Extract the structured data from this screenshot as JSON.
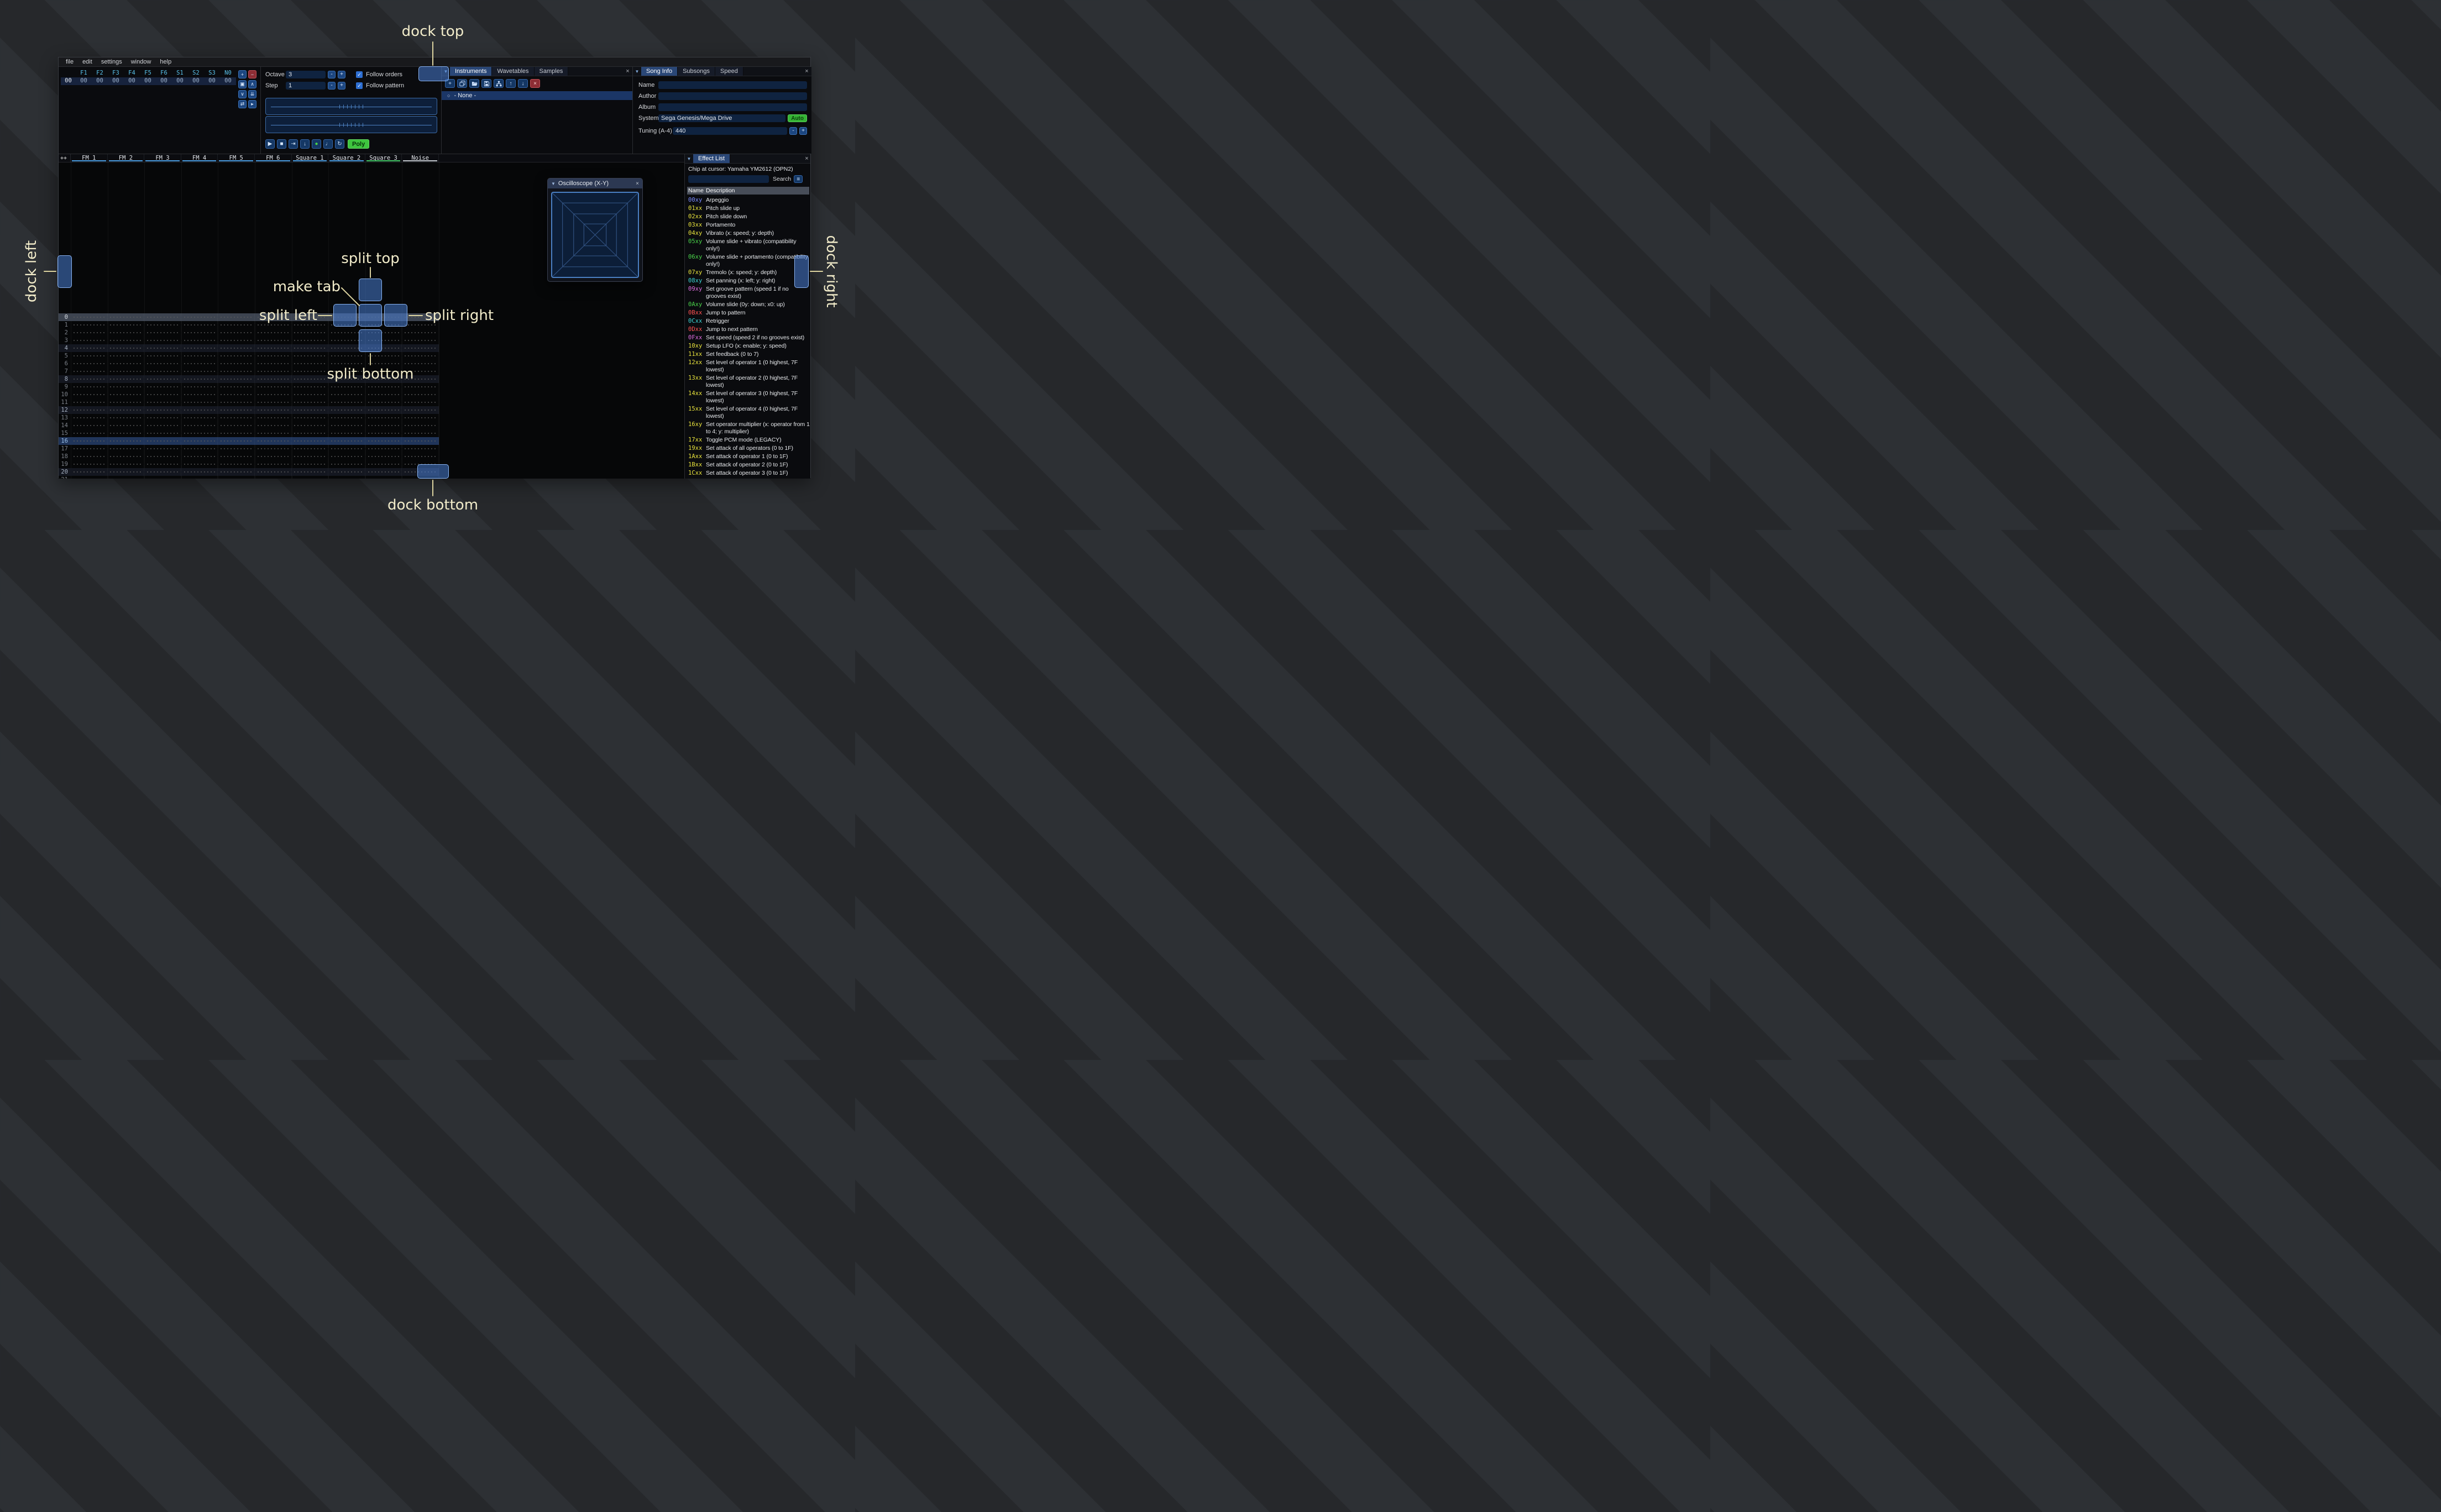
{
  "icons": {
    "collapse": "▼",
    "close": "×",
    "check": "✓",
    "hamburger": "≡",
    "instrument_none": "○",
    "minus": "-",
    "plus": "+"
  },
  "annotations": {
    "dock_top": "dock top",
    "dock_bottom": "dock bottom",
    "dock_left": "dock left",
    "dock_right": "dock right",
    "split_top": "split top",
    "split_bottom": "split bottom",
    "split_left": "split left",
    "split_right": "split right",
    "make_tab": "make tab"
  },
  "menu": {
    "items": [
      "file",
      "edit",
      "settings",
      "window",
      "help"
    ]
  },
  "orders": {
    "header": [
      "F1",
      "F2",
      "F3",
      "F4",
      "F5",
      "F6",
      "S1",
      "S2",
      "S3",
      "N0"
    ],
    "rows": [
      {
        "index": "00",
        "cells": [
          "00",
          "00",
          "00",
          "00",
          "00",
          "00",
          "00",
          "00",
          "00",
          "00"
        ]
      }
    ],
    "buttons": [
      {
        "name": "add-order-button",
        "glyph": "+",
        "style": "blue"
      },
      {
        "name": "remove-order-button",
        "glyph": "−",
        "style": "red"
      },
      {
        "name": "duplicate-order-button",
        "glyph": "▣",
        "style": "blue"
      },
      {
        "name": "move-order-up-button",
        "glyph": "∧",
        "style": "blue"
      },
      {
        "name": "move-order-down-button",
        "glyph": "∨",
        "style": "blue"
      },
      {
        "name": "deep-clone-order-button",
        "glyph": "⇊",
        "style": "blue"
      },
      {
        "name": "order-change-mode-button",
        "glyph": "⇄",
        "style": "blue"
      },
      {
        "name": "order-edit-mode-button",
        "glyph": "▸",
        "style": "blue"
      }
    ]
  },
  "transport": {
    "octave_label": "Octave",
    "octave_value": "3",
    "step_label": "Step",
    "step_value": "1",
    "follow_orders": "Follow orders",
    "follow_pattern": "Follow pattern",
    "poly_label": "Poly",
    "buttons": [
      {
        "name": "play-button",
        "glyph": "▶"
      },
      {
        "name": "stop-button",
        "glyph": "■"
      },
      {
        "name": "play-once-button",
        "glyph": "⇥"
      },
      {
        "name": "step-one-row-button",
        "glyph": "↓"
      },
      {
        "name": "edit-record-toggle",
        "glyph": "●",
        "accent": "#49d449"
      },
      {
        "name": "metronome-button",
        "glyph": "♩"
      },
      {
        "name": "repeat-pattern-button",
        "glyph": "↻"
      }
    ]
  },
  "instruments": {
    "tabs": [
      "Instruments",
      "Wavetables",
      "Samples"
    ],
    "active_tab": 0,
    "toolbar": [
      {
        "name": "add-instrument-button",
        "icon": "plus"
      },
      {
        "name": "duplicate-instrument-button",
        "icon": "duplicate"
      },
      {
        "name": "open-instrument-button",
        "icon": "open"
      },
      {
        "name": "save-instrument-button",
        "icon": "save"
      },
      {
        "name": "instrument-toolbox-button",
        "icon": "sitemap"
      },
      {
        "name": "move-instrument-up-button",
        "icon": "up"
      },
      {
        "name": "move-instrument-down-button",
        "icon": "down"
      },
      {
        "name": "delete-instrument-button",
        "icon": "close",
        "style": "red"
      }
    ],
    "selected_item": "- None -"
  },
  "song_info": {
    "tabs": [
      "Song Info",
      "Subsongs",
      "Speed"
    ],
    "active_tab": 0,
    "fields": [
      {
        "label": "Name",
        "value": ""
      },
      {
        "label": "Author",
        "value": ""
      },
      {
        "label": "Album",
        "value": ""
      }
    ],
    "system_label": "System",
    "system_value": "Sega Genesis/Mega Drive",
    "auto_label": "Auto",
    "tuning_label": "Tuning (A-4)",
    "tuning_value": "440"
  },
  "pattern": {
    "corner_label": "++",
    "channels": [
      {
        "name": "FM 1",
        "color": "#4a9ce0"
      },
      {
        "name": "FM 2",
        "color": "#4a9ce0"
      },
      {
        "name": "FM 3",
        "color": "#4a9ce0"
      },
      {
        "name": "FM 4",
        "color": "#4a9ce0"
      },
      {
        "name": "FM 5",
        "color": "#4a9ce0"
      },
      {
        "name": "FM 6",
        "color": "#4a9ce0"
      },
      {
        "name": "Square 1",
        "color": "#4a9ce0"
      },
      {
        "name": "Square 2",
        "color": "#4a9ce0"
      },
      {
        "name": "Square 3",
        "color": "#43c766"
      },
      {
        "name": "Noise",
        "color": "#c2c7cd"
      }
    ],
    "row_count": 22,
    "cursor_row": 0,
    "playhead_row": 16,
    "highlight_minor": 4
  },
  "oscilloscope": {
    "title": "Oscilloscope (X-Y)"
  },
  "effect_list": {
    "tab": "Effect List",
    "chip_line": "Chip at cursor: Yamaha YM2612 (OPN2)",
    "search_label": "Search",
    "columns": {
      "name": "Name",
      "desc": "Description"
    },
    "effects": [
      {
        "code": "00xy",
        "desc": "Arpeggio",
        "color": "#7b8cff"
      },
      {
        "code": "01xx",
        "desc": "Pitch slide up",
        "color": "#e8e33c"
      },
      {
        "code": "02xx",
        "desc": "Pitch slide down",
        "color": "#e8e33c"
      },
      {
        "code": "03xx",
        "desc": "Portamento",
        "color": "#e8e33c"
      },
      {
        "code": "04xy",
        "desc": "Vibrato (x: speed; y: depth)",
        "color": "#e8e33c"
      },
      {
        "code": "05xy",
        "desc": "Volume slide + vibrato (compatibility only!)",
        "color": "#4ad44a"
      },
      {
        "code": "06xy",
        "desc": "Volume slide + portamento (compatibility only!)",
        "color": "#4ad44a"
      },
      {
        "code": "07xy",
        "desc": "Tremolo (x: speed; y: depth)",
        "color": "#e8e33c"
      },
      {
        "code": "08xy",
        "desc": "Set panning (x: left; y: right)",
        "color": "#3cd4d4"
      },
      {
        "code": "09xy",
        "desc": "Set groove pattern (speed 1 if no grooves exist)",
        "color": "#e06ee0"
      },
      {
        "code": "0Axy",
        "desc": "Volume slide (0y: down; x0: up)",
        "color": "#4ad44a"
      },
      {
        "code": "0Bxx",
        "desc": "Jump to pattern",
        "color": "#ff5252"
      },
      {
        "code": "0Cxx",
        "desc": "Retrigger",
        "color": "#3cd4d4"
      },
      {
        "code": "0Dxx",
        "desc": "Jump to next pattern",
        "color": "#ff5252"
      },
      {
        "code": "0Fxx",
        "desc": "Set speed (speed 2 if no grooves exist)",
        "color": "#e06ee0"
      },
      {
        "code": "10xy",
        "desc": "Setup LFO (x: enable; y: speed)",
        "color": "#e8e33c"
      },
      {
        "code": "11xx",
        "desc": "Set feedback (0 to 7)",
        "color": "#e8e33c"
      },
      {
        "code": "12xx",
        "desc": "Set level of operator 1 (0 highest, 7F lowest)",
        "color": "#e8e33c"
      },
      {
        "code": "13xx",
        "desc": "Set level of operator 2 (0 highest, 7F lowest)",
        "color": "#e8e33c"
      },
      {
        "code": "14xx",
        "desc": "Set level of operator 3 (0 highest, 7F lowest)",
        "color": "#e8e33c"
      },
      {
        "code": "15xx",
        "desc": "Set level of operator 4 (0 highest, 7F lowest)",
        "color": "#e8e33c"
      },
      {
        "code": "16xy",
        "desc": "Set operator multiplier (x: operator from 1 to 4; y: multiplier)",
        "color": "#e8e33c"
      },
      {
        "code": "17xx",
        "desc": "Toggle PCM mode (LEGACY)",
        "color": "#e8e33c"
      },
      {
        "code": "19xx",
        "desc": "Set attack of all operators (0 to 1F)",
        "color": "#e8e33c"
      },
      {
        "code": "1Axx",
        "desc": "Set attack of operator 1 (0 to 1F)",
        "color": "#e8e33c"
      },
      {
        "code": "1Bxx",
        "desc": "Set attack of operator 2 (0 to 1F)",
        "color": "#e8e33c"
      },
      {
        "code": "1Cxx",
        "desc": "Set attack of operator 3 (0 to 1F)",
        "color": "#e8e33c"
      }
    ]
  }
}
